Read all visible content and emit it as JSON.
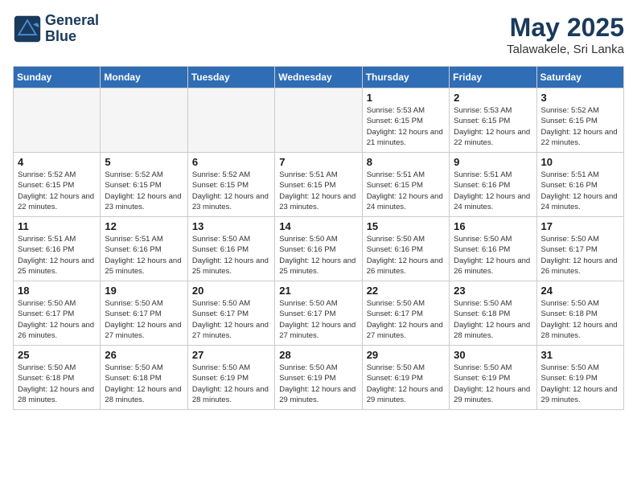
{
  "header": {
    "logo_line1": "General",
    "logo_line2": "Blue",
    "month_year": "May 2025",
    "location": "Talawakele, Sri Lanka"
  },
  "weekdays": [
    "Sunday",
    "Monday",
    "Tuesday",
    "Wednesday",
    "Thursday",
    "Friday",
    "Saturday"
  ],
  "weeks": [
    [
      {
        "day": "",
        "empty": true
      },
      {
        "day": "",
        "empty": true
      },
      {
        "day": "",
        "empty": true
      },
      {
        "day": "",
        "empty": true
      },
      {
        "day": "1",
        "sunrise": "5:53 AM",
        "sunset": "6:15 PM",
        "daylight": "12 hours and 21 minutes."
      },
      {
        "day": "2",
        "sunrise": "5:53 AM",
        "sunset": "6:15 PM",
        "daylight": "12 hours and 22 minutes."
      },
      {
        "day": "3",
        "sunrise": "5:52 AM",
        "sunset": "6:15 PM",
        "daylight": "12 hours and 22 minutes."
      }
    ],
    [
      {
        "day": "4",
        "sunrise": "5:52 AM",
        "sunset": "6:15 PM",
        "daylight": "12 hours and 22 minutes."
      },
      {
        "day": "5",
        "sunrise": "5:52 AM",
        "sunset": "6:15 PM",
        "daylight": "12 hours and 23 minutes."
      },
      {
        "day": "6",
        "sunrise": "5:52 AM",
        "sunset": "6:15 PM",
        "daylight": "12 hours and 23 minutes."
      },
      {
        "day": "7",
        "sunrise": "5:51 AM",
        "sunset": "6:15 PM",
        "daylight": "12 hours and 23 minutes."
      },
      {
        "day": "8",
        "sunrise": "5:51 AM",
        "sunset": "6:15 PM",
        "daylight": "12 hours and 24 minutes."
      },
      {
        "day": "9",
        "sunrise": "5:51 AM",
        "sunset": "6:16 PM",
        "daylight": "12 hours and 24 minutes."
      },
      {
        "day": "10",
        "sunrise": "5:51 AM",
        "sunset": "6:16 PM",
        "daylight": "12 hours and 24 minutes."
      }
    ],
    [
      {
        "day": "11",
        "sunrise": "5:51 AM",
        "sunset": "6:16 PM",
        "daylight": "12 hours and 25 minutes."
      },
      {
        "day": "12",
        "sunrise": "5:51 AM",
        "sunset": "6:16 PM",
        "daylight": "12 hours and 25 minutes."
      },
      {
        "day": "13",
        "sunrise": "5:50 AM",
        "sunset": "6:16 PM",
        "daylight": "12 hours and 25 minutes."
      },
      {
        "day": "14",
        "sunrise": "5:50 AM",
        "sunset": "6:16 PM",
        "daylight": "12 hours and 25 minutes."
      },
      {
        "day": "15",
        "sunrise": "5:50 AM",
        "sunset": "6:16 PM",
        "daylight": "12 hours and 26 minutes."
      },
      {
        "day": "16",
        "sunrise": "5:50 AM",
        "sunset": "6:16 PM",
        "daylight": "12 hours and 26 minutes."
      },
      {
        "day": "17",
        "sunrise": "5:50 AM",
        "sunset": "6:17 PM",
        "daylight": "12 hours and 26 minutes."
      }
    ],
    [
      {
        "day": "18",
        "sunrise": "5:50 AM",
        "sunset": "6:17 PM",
        "daylight": "12 hours and 26 minutes."
      },
      {
        "day": "19",
        "sunrise": "5:50 AM",
        "sunset": "6:17 PM",
        "daylight": "12 hours and 27 minutes."
      },
      {
        "day": "20",
        "sunrise": "5:50 AM",
        "sunset": "6:17 PM",
        "daylight": "12 hours and 27 minutes."
      },
      {
        "day": "21",
        "sunrise": "5:50 AM",
        "sunset": "6:17 PM",
        "daylight": "12 hours and 27 minutes."
      },
      {
        "day": "22",
        "sunrise": "5:50 AM",
        "sunset": "6:17 PM",
        "daylight": "12 hours and 27 minutes."
      },
      {
        "day": "23",
        "sunrise": "5:50 AM",
        "sunset": "6:18 PM",
        "daylight": "12 hours and 28 minutes."
      },
      {
        "day": "24",
        "sunrise": "5:50 AM",
        "sunset": "6:18 PM",
        "daylight": "12 hours and 28 minutes."
      }
    ],
    [
      {
        "day": "25",
        "sunrise": "5:50 AM",
        "sunset": "6:18 PM",
        "daylight": "12 hours and 28 minutes."
      },
      {
        "day": "26",
        "sunrise": "5:50 AM",
        "sunset": "6:18 PM",
        "daylight": "12 hours and 28 minutes."
      },
      {
        "day": "27",
        "sunrise": "5:50 AM",
        "sunset": "6:19 PM",
        "daylight": "12 hours and 28 minutes."
      },
      {
        "day": "28",
        "sunrise": "5:50 AM",
        "sunset": "6:19 PM",
        "daylight": "12 hours and 29 minutes."
      },
      {
        "day": "29",
        "sunrise": "5:50 AM",
        "sunset": "6:19 PM",
        "daylight": "12 hours and 29 minutes."
      },
      {
        "day": "30",
        "sunrise": "5:50 AM",
        "sunset": "6:19 PM",
        "daylight": "12 hours and 29 minutes."
      },
      {
        "day": "31",
        "sunrise": "5:50 AM",
        "sunset": "6:19 PM",
        "daylight": "12 hours and 29 minutes."
      }
    ]
  ]
}
